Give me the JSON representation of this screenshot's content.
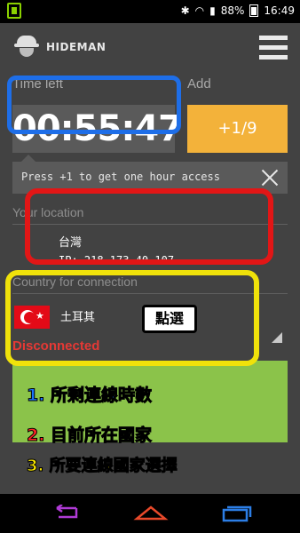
{
  "status_bar": {
    "battery": "88%",
    "time": "16:49",
    "icons": [
      "bluetooth-icon",
      "wifi-icon",
      "signal-icon",
      "battery-icon"
    ]
  },
  "app": {
    "brand": "HIDEMAN",
    "time_left_label": "Time left",
    "add_label": "Add",
    "timer": "00:55:47",
    "add_button": "+1/9",
    "tip": "Press +1 to get one hour access"
  },
  "location": {
    "section_label": "Your location",
    "country": "台灣",
    "ip": "IP: 218.173.40.107"
  },
  "connection": {
    "section_label": "Country for connection",
    "country": "土耳其",
    "status": "Disconnected"
  },
  "annotations": {
    "stamp": "點選",
    "note1": "1. 所剩連線時數",
    "note2": "2. 目前所在國家",
    "note3": "3. 所要連線國家選擇"
  },
  "colors": {
    "accent_add": "#f3b23a",
    "connect_green": "#8bc34a",
    "status_red": "#e53935",
    "highlight_blue": "#1e6ee8",
    "highlight_red": "#e21616",
    "highlight_yellow": "#f0e20a"
  }
}
